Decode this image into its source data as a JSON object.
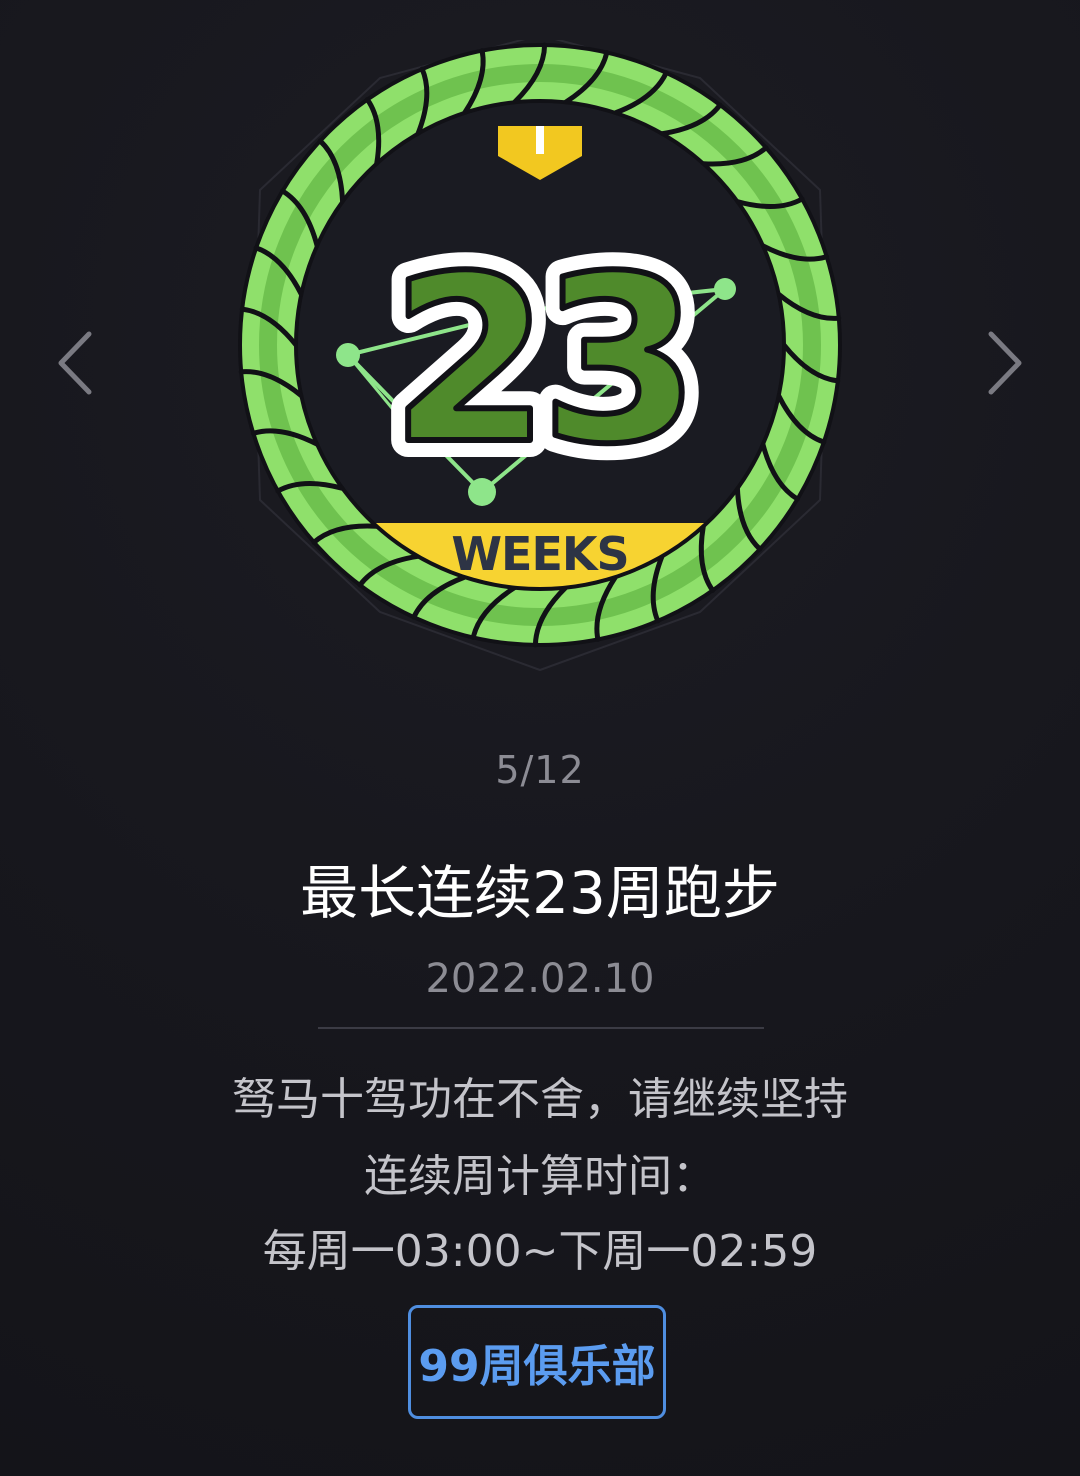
{
  "badge": {
    "number": "23",
    "unit_label": "WEEKS",
    "colors": {
      "ring_light": "#8fe06b",
      "ring_dark": "#5fb84a",
      "number_fill": "#4f8a2b",
      "ribbon": "#f7d331",
      "ribbon_text": "#2d3445",
      "constellation": "#8ee58a"
    }
  },
  "pager": {
    "counter": "5/12",
    "prev_icon": "chevron-left-icon",
    "next_icon": "chevron-right-icon"
  },
  "achievement": {
    "title": "最长连续23周跑步",
    "date": "2022.02.10",
    "motto": "驽马十驾功在不舍，请继续坚持",
    "calc_label": "连续周计算时间：",
    "calc_range": "每周一03:00~下周一02:59"
  },
  "club_button": {
    "label": "99周俱乐部"
  }
}
